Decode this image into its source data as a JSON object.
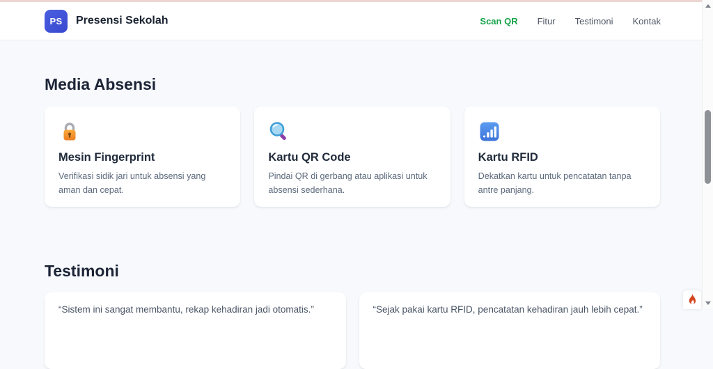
{
  "header": {
    "logo_text": "PS",
    "brand_name": "Presensi Sekolah",
    "nav": [
      {
        "label": "Scan QR",
        "active": true
      },
      {
        "label": "Fitur",
        "active": false
      },
      {
        "label": "Testimoni",
        "active": false
      },
      {
        "label": "Kontak",
        "active": false
      }
    ]
  },
  "sections": {
    "media": {
      "heading": "Media Absensi",
      "cards": [
        {
          "icon": "lock-icon",
          "title": "Mesin Fingerprint",
          "description": "Verifikasi sidik jari untuk absensi yang aman dan cepat."
        },
        {
          "icon": "magnifier-icon",
          "title": "Kartu QR Code",
          "description": "Pindai QR di gerbang atau aplikasi untuk absensi sederhana."
        },
        {
          "icon": "signal-bars-icon",
          "title": "Kartu RFID",
          "description": "Dekatkan kartu untuk pencatatan tanpa antre panjang."
        }
      ]
    },
    "testimoni": {
      "heading": "Testimoni",
      "cards": [
        {
          "quote": "“Sistem ini sangat membantu, rekap kehadiran jadi otomatis.”"
        },
        {
          "quote": "“Sejak pakai kartu RFID, pencatatan kehadiran jauh lebih cepat.”"
        }
      ]
    }
  },
  "floating": {
    "flame_icon": "flame-icon"
  },
  "colors": {
    "accent_green": "#16a34a",
    "brand_blue": "#3e53d8",
    "flame_orange": "#d4471f",
    "page_background": "#f7f9fc",
    "heading_text": "#1c2436"
  }
}
